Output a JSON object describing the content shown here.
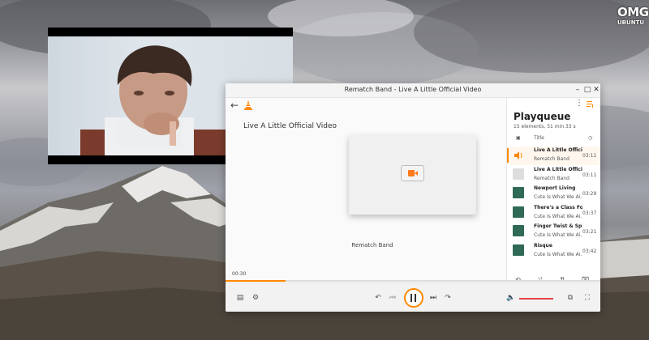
{
  "watermark": {
    "line1": "OMG",
    "line2": "UBUNTU"
  },
  "window": {
    "title": "Rematch Band - Live A Little Official Video"
  },
  "window_controls": {
    "minimize": "–",
    "maximize": "□",
    "close": "✕"
  },
  "player": {
    "media_title": "Live A Little Official Video",
    "artist": "Rematch Band",
    "elapsed": "00:30",
    "progress_fraction": 0.16,
    "volume_fraction": 1.0
  },
  "playqueue": {
    "title": "Playqueue",
    "summary": "15 elements, 51 min 33 s",
    "column_title": "Title",
    "items": [
      {
        "title": "Live A Little Official...",
        "artist": "Rematch Band",
        "duration": "03:11",
        "playing": true,
        "thumb_color": "#ff8800"
      },
      {
        "title": "Live A Little Official V...",
        "artist": "Rematch Band",
        "duration": "03:11",
        "playing": false,
        "thumb_color": "#dddddd"
      },
      {
        "title": "Newport Living",
        "artist": "Cute Is What We Ai...",
        "duration": "03:29",
        "playing": false,
        "thumb_color": "#2f6a57"
      },
      {
        "title": "There's a Class For T...",
        "artist": "Cute Is What We Ai...",
        "duration": "03:37",
        "playing": false,
        "thumb_color": "#2f6a57"
      },
      {
        "title": "Finger Twist & Split",
        "artist": "Cute Is What We Ai...",
        "duration": "03:21",
        "playing": false,
        "thumb_color": "#2f6a57"
      },
      {
        "title": "Risque",
        "artist": "Cute Is What We Ai...",
        "duration": "03:42",
        "playing": false,
        "thumb_color": "#2f6a57"
      }
    ]
  },
  "icons": {
    "back": "←",
    "more": "⋮",
    "clock": "◷",
    "repeat": "⟲",
    "shuffle": "⤨",
    "sort": "⇅",
    "clear": "⌧"
  },
  "colors": {
    "accent": "#ff8800",
    "volume": "#e44444"
  }
}
